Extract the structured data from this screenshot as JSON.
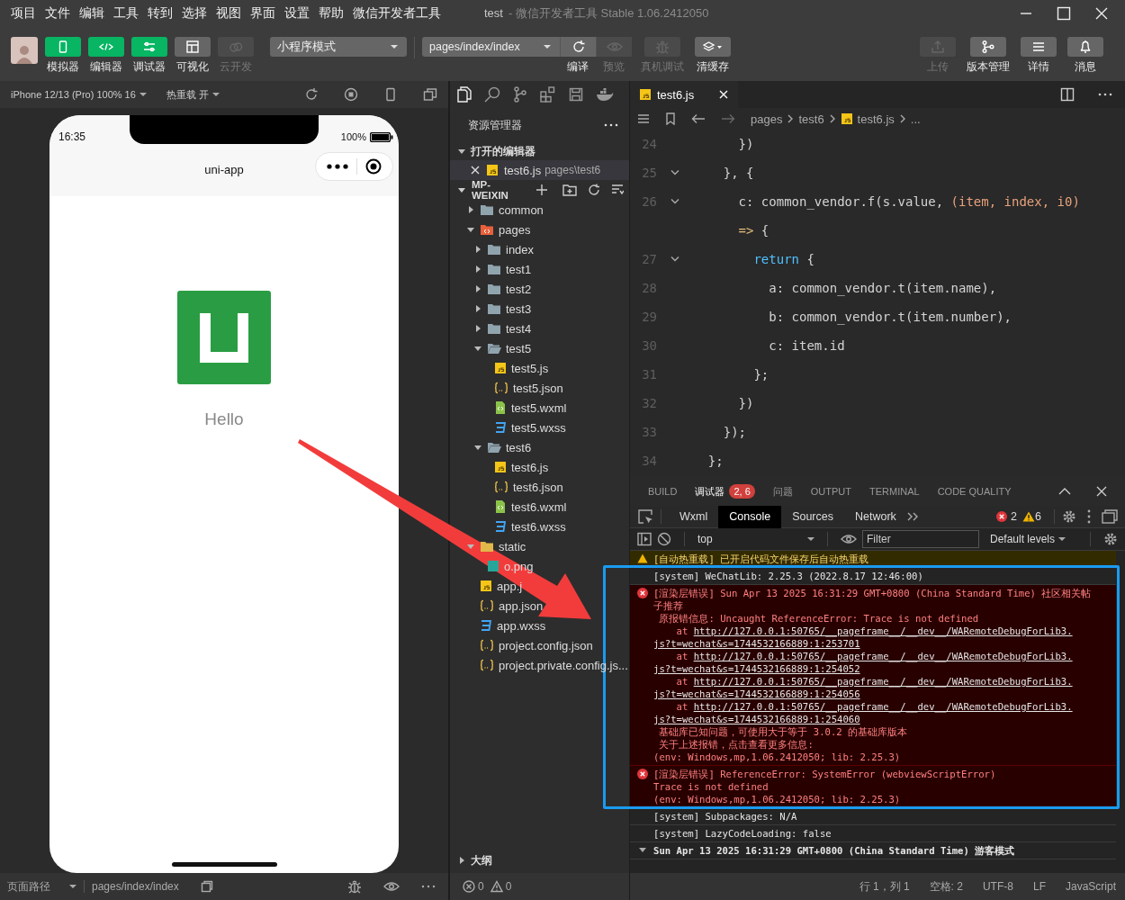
{
  "window": {
    "menu": [
      "项目",
      "文件",
      "编辑",
      "工具",
      "转到",
      "选择",
      "视图",
      "界面",
      "设置",
      "帮助",
      "微信开发者工具"
    ],
    "project": "test",
    "title": "- 微信开发者工具 Stable 1.06.2412050"
  },
  "toolbar": {
    "left_buttons": [
      {
        "label": "模拟器",
        "on": true,
        "disabled": false
      },
      {
        "label": "编辑器",
        "on": true,
        "disabled": false
      },
      {
        "label": "调试器",
        "on": true,
        "disabled": false
      },
      {
        "label": "可视化",
        "on": false,
        "disabled": false
      },
      {
        "label": "云开发",
        "on": false,
        "disabled": true
      }
    ],
    "mode": "小程序模式",
    "page": "pages/index/index",
    "compile_buttons": [
      {
        "label": "编译",
        "disabled": false
      },
      {
        "label": "预览",
        "disabled": true
      },
      {
        "label": "真机调试",
        "disabled": true
      },
      {
        "label": "清缓存",
        "disabled": false
      }
    ],
    "right_buttons": [
      {
        "label": "上传",
        "disabled": true
      },
      {
        "label": "版本管理",
        "disabled": false
      },
      {
        "label": "详情",
        "disabled": false
      },
      {
        "label": "消息",
        "disabled": false
      }
    ]
  },
  "simulator": {
    "device": "iPhone 12/13 (Pro) 100% 16",
    "hot_reload": "热重载 开",
    "time": "16:35",
    "battery": "100%",
    "nav_title": "uni-app",
    "text": "Hello",
    "footer": {
      "label": "页面路径",
      "path": "pages/index/index"
    }
  },
  "explorer": {
    "title": "资源管理器",
    "open_editors": "打开的编辑器",
    "open_files": [
      {
        "name": "test6.js",
        "path": "pages\\test6",
        "kind": "js"
      }
    ],
    "root": "MP-WEIXIN",
    "tree": [
      {
        "name": "common",
        "kind": "folder",
        "expanded": false
      },
      {
        "name": "pages",
        "kind": "page-folder",
        "expanded": true,
        "children": [
          {
            "name": "index",
            "kind": "folder",
            "expanded": false
          },
          {
            "name": "test1",
            "kind": "folder",
            "expanded": false
          },
          {
            "name": "test2",
            "kind": "folder",
            "expanded": false
          },
          {
            "name": "test3",
            "kind": "folder",
            "expanded": false
          },
          {
            "name": "test4",
            "kind": "folder",
            "expanded": false
          },
          {
            "name": "test5",
            "kind": "folder",
            "expanded": true,
            "children": [
              {
                "name": "test5.js",
                "kind": "js"
              },
              {
                "name": "test5.json",
                "kind": "json"
              },
              {
                "name": "test5.wxml",
                "kind": "wxml"
              },
              {
                "name": "test5.wxss",
                "kind": "wxss"
              }
            ]
          },
          {
            "name": "test6",
            "kind": "folder",
            "expanded": true,
            "children": [
              {
                "name": "test6.js",
                "kind": "js"
              },
              {
                "name": "test6.json",
                "kind": "json"
              },
              {
                "name": "test6.wxml",
                "kind": "wxml"
              },
              {
                "name": "test6.wxss",
                "kind": "wxss"
              }
            ]
          }
        ]
      },
      {
        "name": "static",
        "kind": "asset-folder",
        "expanded": true,
        "children": [
          {
            "name": "o.png",
            "kind": "png"
          }
        ]
      },
      {
        "name": "app.j",
        "kind": "js"
      },
      {
        "name": "app.json",
        "kind": "json"
      },
      {
        "name": "app.wxss",
        "kind": "wxss"
      },
      {
        "name": "project.config.json",
        "kind": "json"
      },
      {
        "name": "project.private.config.js...",
        "kind": "json"
      }
    ],
    "outline": "大纲",
    "problems": {
      "errors": "0",
      "warnings": "0"
    }
  },
  "editor": {
    "tab": "test6.js",
    "breadcrumb": [
      "pages",
      "test6",
      "test6.js",
      "..."
    ],
    "lines": [
      {
        "number": "24",
        "foldable": false,
        "tokens": [
          {
            "text": "      })",
            "kind": "plain"
          }
        ]
      },
      {
        "number": "25",
        "foldable": true,
        "tokens": [
          {
            "text": "    }, {",
            "kind": "plain"
          }
        ]
      },
      {
        "number": "26",
        "foldable": true,
        "tokens": [
          {
            "text": "      c: common_vendor.f(s.value, ",
            "kind": "plain"
          },
          {
            "text": "(item, index, i0)",
            "kind": "param"
          }
        ],
        "continuation": [
          {
            "text": "      =>",
            "kind": "operator"
          },
          {
            "text": " {",
            "kind": "plain"
          }
        ]
      },
      {
        "number": "27",
        "foldable": true,
        "tokens": [
          {
            "text": "        return",
            "kind": "keyword"
          },
          {
            "text": " {",
            "kind": "plain"
          }
        ]
      },
      {
        "number": "28",
        "foldable": false,
        "tokens": [
          {
            "text": "          a: common_vendor.t(item.name),",
            "kind": "plain"
          }
        ]
      },
      {
        "number": "29",
        "foldable": false,
        "tokens": [
          {
            "text": "          b: common_vendor.t(item.number),",
            "kind": "plain"
          }
        ]
      },
      {
        "number": "30",
        "foldable": false,
        "tokens": [
          {
            "text": "          c: item.id",
            "kind": "plain"
          }
        ]
      },
      {
        "number": "31",
        "foldable": false,
        "tokens": [
          {
            "text": "        };",
            "kind": "plain"
          }
        ]
      },
      {
        "number": "32",
        "foldable": false,
        "tokens": [
          {
            "text": "      })",
            "kind": "plain"
          }
        ]
      },
      {
        "number": "33",
        "foldable": false,
        "tokens": [
          {
            "text": "    });",
            "kind": "plain"
          }
        ]
      },
      {
        "number": "34",
        "foldable": false,
        "tokens": [
          {
            "text": "  };",
            "kind": "plain"
          }
        ]
      }
    ],
    "status": [
      "行 1，列 1",
      "空格: 2",
      "UTF-8",
      "LF",
      "JavaScript"
    ]
  },
  "panel": {
    "tabs": [
      {
        "label": "BUILD",
        "selected": false
      },
      {
        "label": "调试器",
        "selected": true,
        "badge": "2, 6"
      },
      {
        "label": "问题",
        "selected": false
      },
      {
        "label": "OUTPUT",
        "selected": false
      },
      {
        "label": "TERMINAL",
        "selected": false
      },
      {
        "label": "CODE QUALITY",
        "selected": false
      }
    ],
    "devtools_tabs": [
      {
        "label": "Wxml",
        "selected": false
      },
      {
        "label": "Console",
        "selected": true
      },
      {
        "label": "Sources",
        "selected": false
      },
      {
        "label": "Network",
        "selected": false
      }
    ],
    "errors": "2",
    "warnings": "6",
    "context": "top",
    "filter": {
      "placeholder": "Filter"
    },
    "levels": "Default levels",
    "messages": [
      {
        "kind": "warning",
        "lines": [
          {
            "text": "[自动热重载] 已开启代码文件保存后自动热重载"
          }
        ]
      },
      {
        "kind": "system",
        "lines": [
          {
            "text": "[system] WeChatLib: 2.25.3 (2022.8.17 12:46:00)"
          }
        ]
      },
      {
        "kind": "error",
        "lines": [
          {
            "text": "[渲染层错误] Sun Apr 13 2025 16:31:29 GMT+0800 (China Standard Time) 社区相关帖子推荐"
          },
          {
            "text": " 原报错信息: Uncaught ReferenceError: Trace is not defined"
          },
          {
            "text": "    at ",
            "link": "http://127.0.0.1:50765/__pageframe__/__dev__/WARemoteDebugForLib3."
          },
          {
            "link": "js?t=wechat&s=1744532166889:1:253701"
          },
          {
            "text": "    at ",
            "link": "http://127.0.0.1:50765/__pageframe__/__dev__/WARemoteDebugForLib3."
          },
          {
            "link": "js?t=wechat&s=1744532166889:1:254052"
          },
          {
            "text": "    at ",
            "link": "http://127.0.0.1:50765/__pageframe__/__dev__/WARemoteDebugForLib3."
          },
          {
            "link": "js?t=wechat&s=1744532166889:1:254056"
          },
          {
            "text": "    at ",
            "link": "http://127.0.0.1:50765/__pageframe__/__dev__/WARemoteDebugForLib3."
          },
          {
            "link": "js?t=wechat&s=1744532166889:1:254060"
          },
          {
            "text": " 基础库已知问题，可使用大于等于 3.0.2 的基础库版本"
          },
          {
            "text": " 关于上述报错，点击查看更多信息:"
          },
          {
            "text": "(env: Windows,mp,1.06.2412050; lib: 2.25.3)"
          }
        ]
      },
      {
        "kind": "error",
        "lines": [
          {
            "text": "[渲染层错误] ReferenceError: SystemError (webviewScriptError)"
          },
          {
            "text": "Trace is not defined"
          },
          {
            "text": "(env: Windows,mp,1.06.2412050; lib: 2.25.3)"
          }
        ]
      },
      {
        "kind": "system",
        "lines": [
          {
            "text": "[system] Subpackages: N/A"
          }
        ]
      },
      {
        "kind": "system",
        "lines": [
          {
            "text": "[system] LazyCodeLoading: false"
          }
        ]
      },
      {
        "kind": "group",
        "expanded": true,
        "lines": [
          {
            "text": "Sun Apr 13 2025 16:31:29 GMT+0800 (China Standard Time) 游客模式"
          }
        ]
      }
    ]
  }
}
